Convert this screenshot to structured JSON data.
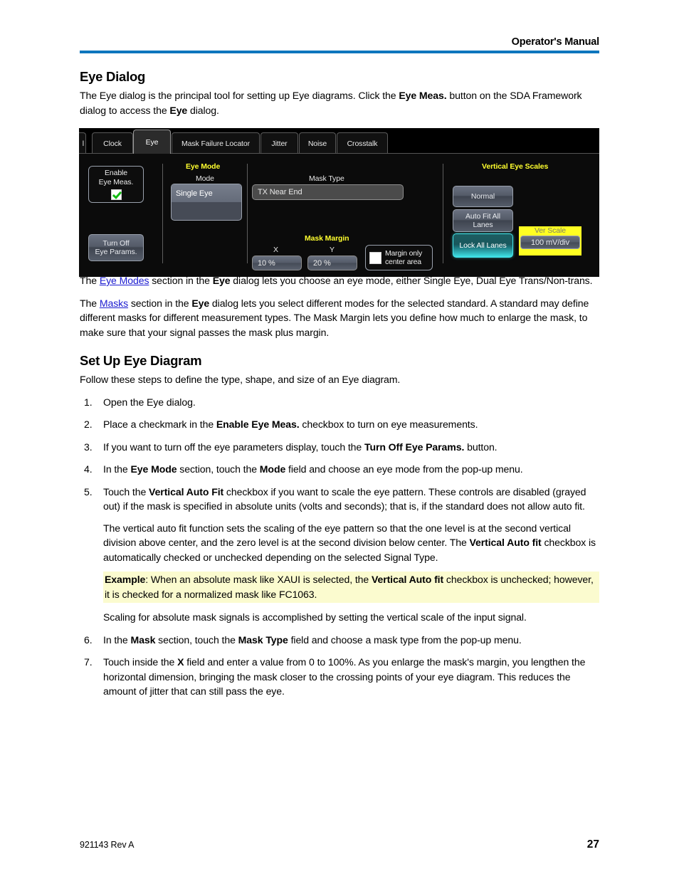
{
  "header": {
    "title": "Operator's Manual",
    "rule_color": "#0d76bd"
  },
  "sections": {
    "eye_dialog_heading": "Eye Dialog",
    "eye_dialog_intro_1": "The Eye dialog is the principal tool for setting up Eye diagrams. Click the ",
    "eye_dialog_intro_b1": "Eye Meas.",
    "eye_dialog_intro_2": " button on the SDA Framework dialog to access the ",
    "eye_dialog_intro_b2": "Eye",
    "eye_dialog_intro_3": "  dialog.",
    "eye_modes_p_1": "The ",
    "eye_modes_link": "Eye Modes",
    "eye_modes_p_2": " section in the ",
    "eye_modes_b": "Eye",
    "eye_modes_p_3": "  dialog lets you choose an eye mode, either Single Eye, Dual Eye Trans/Non-trans.",
    "masks_p_1": "The ",
    "masks_link": "Masks",
    "masks_p_2": " section in the ",
    "masks_b": "Eye",
    "masks_p_3": "  dialog lets you select different modes for the selected standard. A standard may define different masks for different measurement types. The Mask Margin lets you define how much to enlarge the mask, to make sure that your signal passes the mask plus margin.",
    "setup_heading": "Set Up Eye Diagram",
    "setup_intro": "Follow these steps to define the type, shape, and size of an Eye diagram."
  },
  "steps": {
    "s1": "Open the Eye dialog.",
    "s2_a": "Place a checkmark in the ",
    "s2_b": "Enable Eye Meas.",
    "s2_c": " checkbox to turn on eye measurements.",
    "s3_a": "If you want to turn off the eye parameters display, touch the ",
    "s3_b": "Turn Off Eye Params.",
    "s3_c": " button.",
    "s4_a": "In the ",
    "s4_b1": "Eye Mode",
    "s4_b": " section, touch the ",
    "s4_b2": "Mode",
    "s4_c": " field and choose an eye mode from the pop-up menu.",
    "s5_a": "Touch the ",
    "s5_b1": "Vertical Auto Fit",
    "s5_c": " checkbox if you want to scale the eye pattern. These controls are disabled (grayed out) if the mask is specified in absolute units (volts and seconds); that is, if the standard does not allow auto fit.",
    "s5_p2_a": "The vertical auto fit function sets the scaling of the eye pattern so that the one level is at the second vertical division above center, and the zero level is at the second division below center. The ",
    "s5_p2_b": "Vertical Auto fit",
    "s5_p2_c": " checkbox is automatically checked or unchecked depending on the selected Signal Type.",
    "example_b": "Example",
    "example_a": ": When an absolute mask like XAUI is selected, the ",
    "example_b2": "Vertical Auto fit",
    "example_c": " checkbox is unchecked; however, it is checked for a normalized mask like FC1063.",
    "s5_p4": "Scaling for absolute mask signals is accomplished by setting the vertical scale of the input signal.",
    "s6_a": "In the ",
    "s6_b1": "Mask",
    "s6_b": " section, touch the ",
    "s6_b2": "Mask Type",
    "s6_c": " field and choose a mask type from the pop-up menu.",
    "s7_a": "Touch inside the ",
    "s7_b1": "X",
    "s7_c": " field and enter a value from 0 to 100%. As you enlarge the mask's margin, you lengthen the horizontal dimension, bringing the mask closer to the crossing points of your eye diagram. This reduces the amount of jitter that can still pass the eye."
  },
  "example_highlight_color": "#fbfbcf",
  "scope_dialog": {
    "tabs": [
      {
        "label": "l",
        "active": false,
        "partial": true
      },
      {
        "label": "Clock",
        "active": false
      },
      {
        "label": "Eye",
        "active": true
      },
      {
        "label": "Mask Failure Locator",
        "active": false
      },
      {
        "label": "Jitter",
        "active": false
      },
      {
        "label": "Noise",
        "active": false
      },
      {
        "label": "Crosstalk",
        "active": false
      }
    ],
    "enable_group": {
      "line1": "Enable",
      "line2": "Eye Meas.",
      "checked": true
    },
    "turn_off_button": "Turn Off\nEye Params.",
    "turn_off_line1": "Turn Off",
    "turn_off_line2": "Eye Params.",
    "eye_mode": {
      "group_label": "Eye Mode",
      "mode_label": "Mode",
      "selected": "Single Eye",
      "empty_row": ""
    },
    "mask": {
      "mask_type_label": "Mask Type",
      "mask_type_value": "TX Near End",
      "mask_margin_label": "Mask Margin",
      "x_label": "X",
      "y_label": "Y",
      "x_value": "10 %",
      "y_value": "20 %",
      "margin_only_line1": "Margin only",
      "margin_only_line2": "center area",
      "margin_only_checked": false
    },
    "vertical_eye_scales": {
      "group_label": "Vertical Eye Scales",
      "normal_button": "Normal",
      "autofit_line1": "Auto Fit All",
      "autofit_line2": "Lanes",
      "lock_button": "Lock All Lanes",
      "lock_active": true,
      "ver_scale_label": "Ver Scale",
      "ver_scale_value": "100 mV/div",
      "highlight_color": "#ffff22",
      "lit_color": "#40e6ec"
    }
  },
  "footer": {
    "doc_id": "921143 Rev A",
    "page_number": "27"
  }
}
